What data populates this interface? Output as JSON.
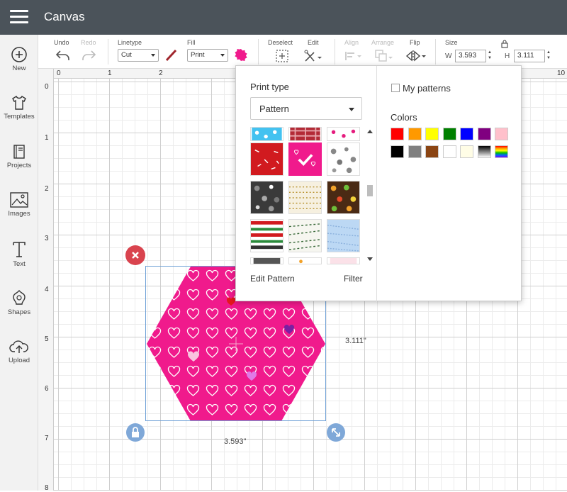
{
  "app": {
    "title": "Canvas"
  },
  "sidebar": {
    "items": [
      {
        "label": "New",
        "icon": "plus-circle-icon"
      },
      {
        "label": "Templates",
        "icon": "shirt-icon"
      },
      {
        "label": "Projects",
        "icon": "notebook-icon"
      },
      {
        "label": "Images",
        "icon": "image-icon"
      },
      {
        "label": "Text",
        "icon": "text-icon"
      },
      {
        "label": "Shapes",
        "icon": "shapes-icon"
      },
      {
        "label": "Upload",
        "icon": "cloud-upload-icon"
      }
    ]
  },
  "toolbar": {
    "undo_label": "Undo",
    "redo_label": "Redo",
    "linetype_label": "Linetype",
    "linetype_value": "Cut",
    "fill_label": "Fill",
    "fill_value": "Print",
    "deselect_label": "Deselect",
    "edit_label": "Edit",
    "align_label": "Align",
    "arrange_label": "Arrange",
    "flip_label": "Flip",
    "size_label": "Size",
    "width_label": "W",
    "width_value": "3.593",
    "height_label": "H",
    "height_value": "3.111",
    "line_color": "#a0262d",
    "fill_color": "#f01a8c"
  },
  "rulers": {
    "top": [
      "0",
      "1",
      "2",
      "10"
    ],
    "left": [
      "0",
      "1",
      "2",
      "3",
      "4",
      "5",
      "6",
      "7",
      "8"
    ]
  },
  "selection": {
    "width_text": "3.593\"",
    "height_text": "3.111\""
  },
  "popup": {
    "print_type_title": "Print type",
    "print_type_value": "Pattern",
    "edit_pattern_label": "Edit Pattern",
    "filter_label": "Filter",
    "my_patterns_label": "My patterns",
    "colors_title": "Colors",
    "colors": [
      "#ff0000",
      "#ff9900",
      "#ffff00",
      "#008000",
      "#0000ff",
      "#800080",
      "#ffc0cb",
      "#000000",
      "#808080",
      "#8b4513",
      "#ffffff",
      "#fffde6",
      "gradient-black-white",
      "rainbow"
    ]
  }
}
